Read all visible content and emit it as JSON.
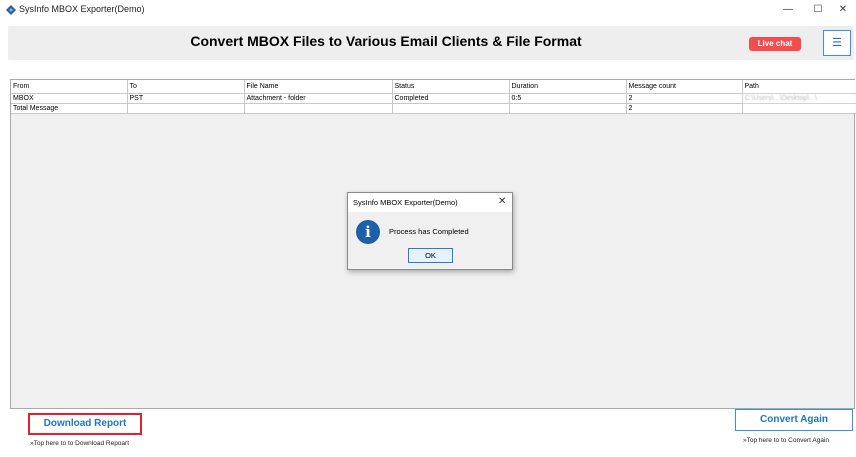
{
  "window": {
    "title": "SysInfo MBOX Exporter(Demo)",
    "minimize": "—",
    "maximize": "☐",
    "close": "✕"
  },
  "header": {
    "title": "Convert MBOX Files to Various Email Clients & File Format",
    "live_chat": "Live chat",
    "menu_icon": "☰"
  },
  "grid": {
    "columns": [
      "From",
      "To",
      "File Name",
      "Status",
      "Duration",
      "Message count",
      "Path"
    ],
    "rows": [
      [
        "MBOX",
        "PST",
        "Attachment - folder",
        "Completed",
        "0:5",
        "2",
        "C:\\Users\\...\\Desktop\\...\\"
      ],
      [
        "Total Message",
        "",
        "",
        "",
        "",
        "2",
        ""
      ]
    ]
  },
  "dialog": {
    "title": "SysInfo MBOX Exporter(Demo)",
    "close": "✕",
    "icon": "i",
    "message": "Process has Completed",
    "ok": "OK"
  },
  "footer": {
    "download_button": "Download Report",
    "download_hint": "»Top here to to Download Repoart",
    "convert_button": "Convert Again",
    "convert_hint": "»Top here to to Convert Again"
  },
  "colors": {
    "accent_blue": "#1f73c6",
    "live_chat_red": "#f44c4f",
    "highlight_red": "#e0232c"
  }
}
